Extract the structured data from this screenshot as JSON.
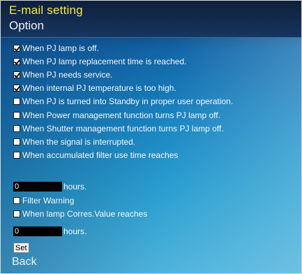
{
  "header": {
    "title": "E-mail setting",
    "subtitle": "Option"
  },
  "options": [
    {
      "label": "When PJ lamp is off.",
      "checked": true
    },
    {
      "label": "When PJ lamp replacement time is reached.",
      "checked": true
    },
    {
      "label": "When PJ needs service.",
      "checked": true
    },
    {
      "label": "When internal PJ temperature is too high.",
      "checked": true
    },
    {
      "label": "When PJ is turned into Standby in proper user operation.",
      "checked": false
    },
    {
      "label": "When Power management function turns PJ lamp off.",
      "checked": false
    },
    {
      "label": "When Shutter management function turns PJ lamp off.",
      "checked": false
    },
    {
      "label": "When the signal is interrupted.",
      "checked": false
    },
    {
      "label": "When accumulated filter use time reaches",
      "checked": false
    }
  ],
  "filter_hours": {
    "value": "0",
    "unit": "hours."
  },
  "more_options": [
    {
      "label": "Filter Warning",
      "checked": false
    },
    {
      "label": "When lamp Corres.Value reaches",
      "checked": false
    }
  ],
  "lamp_hours": {
    "value": "0",
    "unit": "hours."
  },
  "actions": {
    "set_label": "Set",
    "back_label": "Back"
  }
}
